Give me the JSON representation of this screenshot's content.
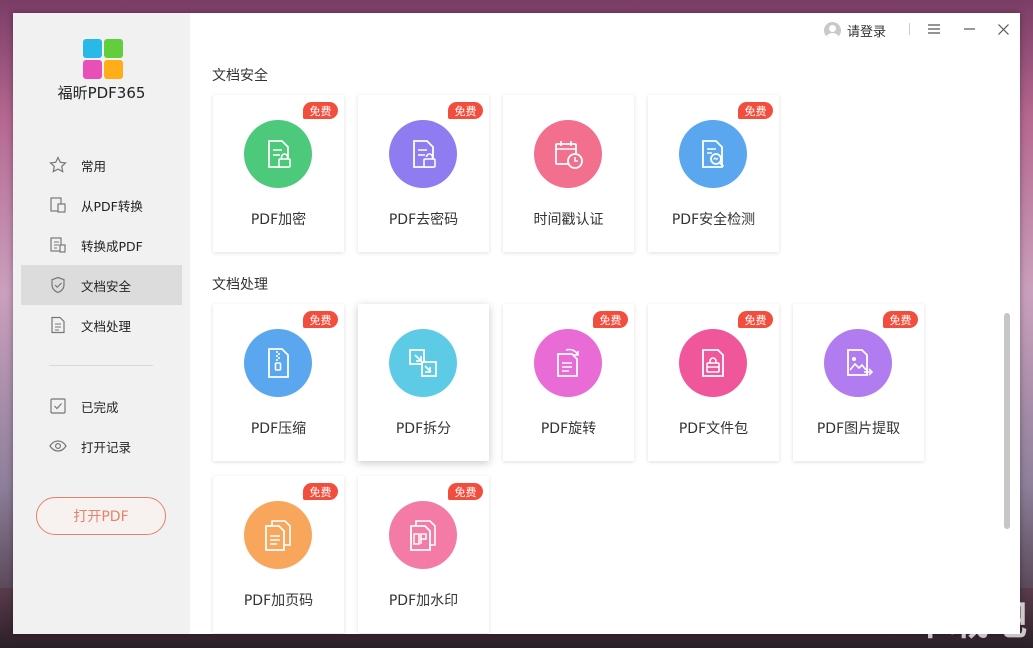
{
  "app": {
    "title": "福昕PDF365"
  },
  "topbar": {
    "login_label": "请登录"
  },
  "sidebar": {
    "items": [
      {
        "label": "常用",
        "icon": "star-icon"
      },
      {
        "label": "从PDF转换",
        "icon": "pdf-convert-from-icon"
      },
      {
        "label": "转换成PDF",
        "icon": "pdf-convert-to-icon"
      },
      {
        "label": "文档安全",
        "icon": "shield-icon",
        "active": true
      },
      {
        "label": "文档处理",
        "icon": "document-icon"
      },
      {
        "label": "已完成",
        "icon": "check-icon"
      },
      {
        "label": "打开记录",
        "icon": "eye-icon"
      }
    ],
    "open_button": "打开PDF"
  },
  "sections": [
    {
      "title": "文档安全",
      "cards": [
        {
          "label": "PDF加密",
          "badge": "免费",
          "color": "#4cc97a",
          "icon": "lock-document-icon"
        },
        {
          "label": "PDF去密码",
          "badge": "免费",
          "color": "#8f7cf0",
          "icon": "unlock-document-icon"
        },
        {
          "label": "时间戳认证",
          "badge": "",
          "color": "#f36f8e",
          "icon": "calendar-clock-icon"
        },
        {
          "label": "PDF安全检测",
          "badge": "免费",
          "color": "#5aa7f0",
          "icon": "scan-document-icon"
        }
      ]
    },
    {
      "title": "文档处理",
      "cards": [
        {
          "label": "PDF压缩",
          "badge": "免费",
          "color": "#5aa7f0",
          "icon": "zip-document-icon"
        },
        {
          "label": "PDF拆分",
          "badge": "",
          "color": "#5ecbe6",
          "icon": "split-icon"
        },
        {
          "label": "PDF旋转",
          "badge": "免费",
          "color": "#e86bd6",
          "icon": "rotate-document-icon"
        },
        {
          "label": "PDF文件包",
          "badge": "免费",
          "color": "#f0569a",
          "icon": "package-icon"
        },
        {
          "label": "PDF图片提取",
          "badge": "免费",
          "color": "#b07cf0",
          "icon": "image-extract-icon"
        },
        {
          "label": "PDF加页码",
          "badge": "免费",
          "color": "#f7a65c",
          "icon": "page-number-icon"
        },
        {
          "label": "PDF加水印",
          "badge": "免费",
          "color": "#f47ba6",
          "icon": "watermark-icon"
        }
      ]
    }
  ],
  "watermark_text": "下载吧"
}
